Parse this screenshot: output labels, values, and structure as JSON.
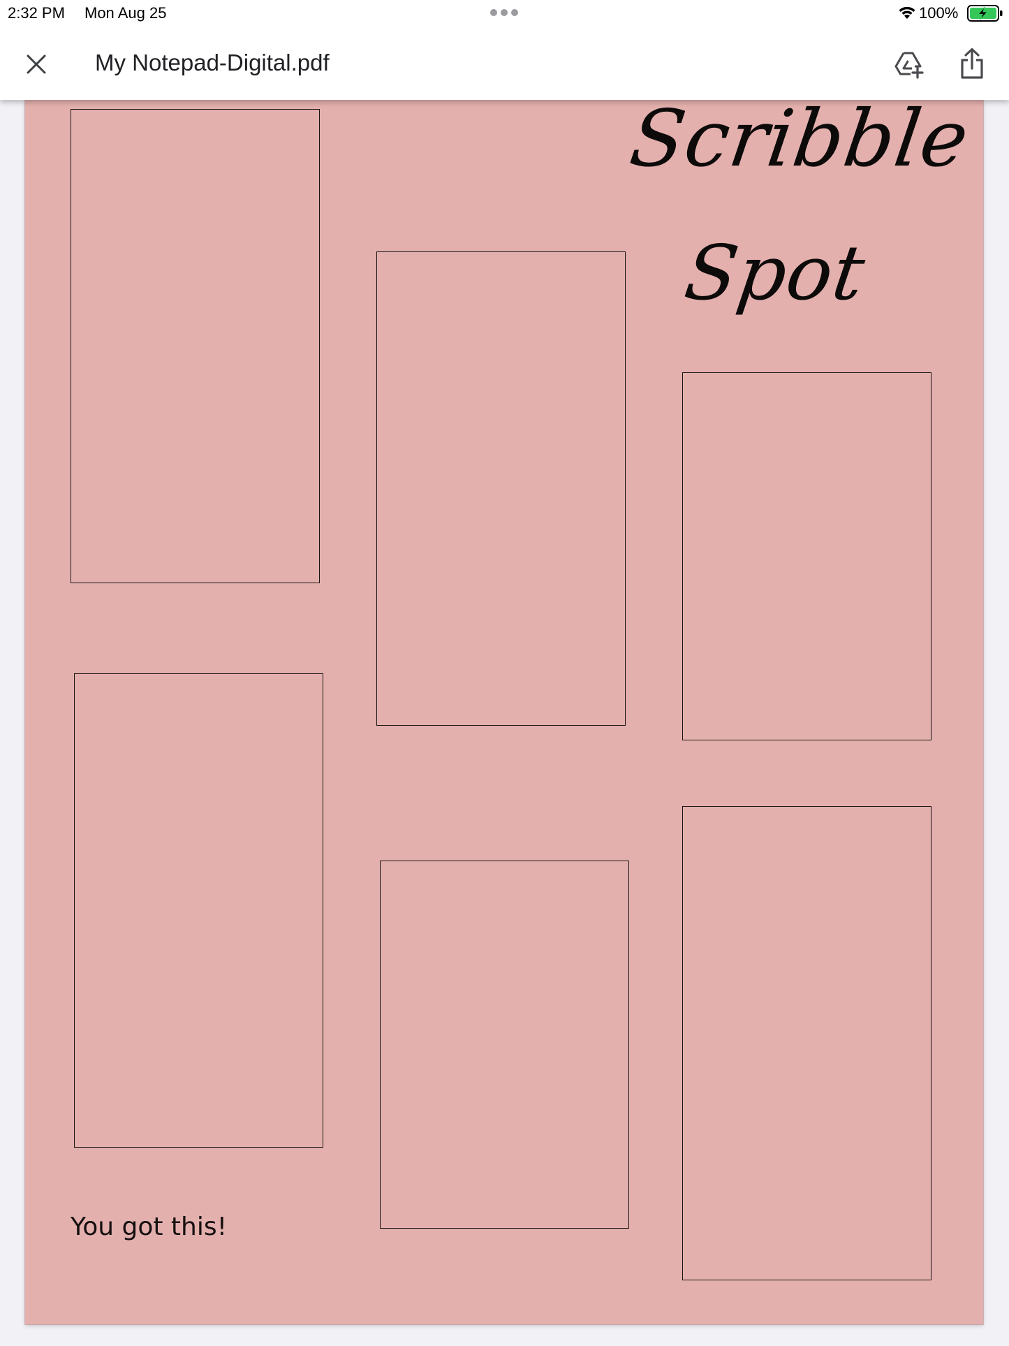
{
  "status_bar": {
    "time": "2:32 PM",
    "date": "Mon Aug 25",
    "battery_percent": "100%",
    "icons": [
      "multitasking-dots-icon",
      "wifi-icon",
      "battery-charging-icon"
    ]
  },
  "toolbar": {
    "title": "My Notepad-Digital.pdf",
    "icons": [
      "close-icon",
      "add-to-drive-icon",
      "share-icon"
    ]
  },
  "document": {
    "title_line_1": "Scribble",
    "title_line_2": "Spot",
    "motto": "You got this!",
    "page_color": "#e3b0ad",
    "note_box_count": 6
  }
}
